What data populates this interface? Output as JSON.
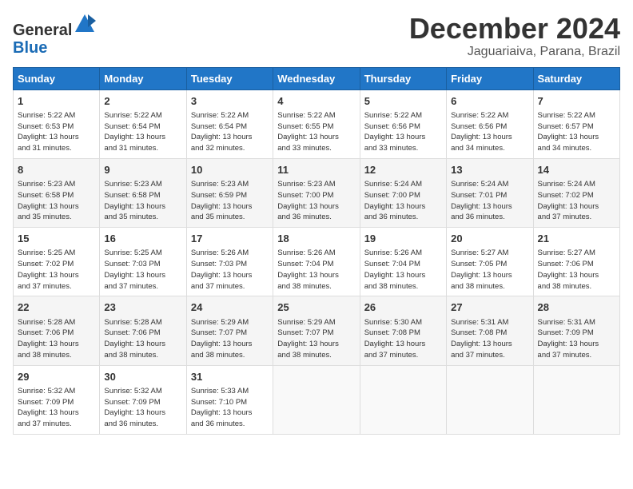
{
  "header": {
    "logo_line1": "General",
    "logo_line2": "Blue",
    "month": "December 2024",
    "location": "Jaguariaiva, Parana, Brazil"
  },
  "days_of_week": [
    "Sunday",
    "Monday",
    "Tuesday",
    "Wednesday",
    "Thursday",
    "Friday",
    "Saturday"
  ],
  "weeks": [
    [
      {
        "day": "1",
        "info": "Sunrise: 5:22 AM\nSunset: 6:53 PM\nDaylight: 13 hours\nand 31 minutes."
      },
      {
        "day": "2",
        "info": "Sunrise: 5:22 AM\nSunset: 6:54 PM\nDaylight: 13 hours\nand 31 minutes."
      },
      {
        "day": "3",
        "info": "Sunrise: 5:22 AM\nSunset: 6:54 PM\nDaylight: 13 hours\nand 32 minutes."
      },
      {
        "day": "4",
        "info": "Sunrise: 5:22 AM\nSunset: 6:55 PM\nDaylight: 13 hours\nand 33 minutes."
      },
      {
        "day": "5",
        "info": "Sunrise: 5:22 AM\nSunset: 6:56 PM\nDaylight: 13 hours\nand 33 minutes."
      },
      {
        "day": "6",
        "info": "Sunrise: 5:22 AM\nSunset: 6:56 PM\nDaylight: 13 hours\nand 34 minutes."
      },
      {
        "day": "7",
        "info": "Sunrise: 5:22 AM\nSunset: 6:57 PM\nDaylight: 13 hours\nand 34 minutes."
      }
    ],
    [
      {
        "day": "8",
        "info": "Sunrise: 5:23 AM\nSunset: 6:58 PM\nDaylight: 13 hours\nand 35 minutes."
      },
      {
        "day": "9",
        "info": "Sunrise: 5:23 AM\nSunset: 6:58 PM\nDaylight: 13 hours\nand 35 minutes."
      },
      {
        "day": "10",
        "info": "Sunrise: 5:23 AM\nSunset: 6:59 PM\nDaylight: 13 hours\nand 35 minutes."
      },
      {
        "day": "11",
        "info": "Sunrise: 5:23 AM\nSunset: 7:00 PM\nDaylight: 13 hours\nand 36 minutes."
      },
      {
        "day": "12",
        "info": "Sunrise: 5:24 AM\nSunset: 7:00 PM\nDaylight: 13 hours\nand 36 minutes."
      },
      {
        "day": "13",
        "info": "Sunrise: 5:24 AM\nSunset: 7:01 PM\nDaylight: 13 hours\nand 36 minutes."
      },
      {
        "day": "14",
        "info": "Sunrise: 5:24 AM\nSunset: 7:02 PM\nDaylight: 13 hours\nand 37 minutes."
      }
    ],
    [
      {
        "day": "15",
        "info": "Sunrise: 5:25 AM\nSunset: 7:02 PM\nDaylight: 13 hours\nand 37 minutes."
      },
      {
        "day": "16",
        "info": "Sunrise: 5:25 AM\nSunset: 7:03 PM\nDaylight: 13 hours\nand 37 minutes."
      },
      {
        "day": "17",
        "info": "Sunrise: 5:26 AM\nSunset: 7:03 PM\nDaylight: 13 hours\nand 37 minutes."
      },
      {
        "day": "18",
        "info": "Sunrise: 5:26 AM\nSunset: 7:04 PM\nDaylight: 13 hours\nand 38 minutes."
      },
      {
        "day": "19",
        "info": "Sunrise: 5:26 AM\nSunset: 7:04 PM\nDaylight: 13 hours\nand 38 minutes."
      },
      {
        "day": "20",
        "info": "Sunrise: 5:27 AM\nSunset: 7:05 PM\nDaylight: 13 hours\nand 38 minutes."
      },
      {
        "day": "21",
        "info": "Sunrise: 5:27 AM\nSunset: 7:06 PM\nDaylight: 13 hours\nand 38 minutes."
      }
    ],
    [
      {
        "day": "22",
        "info": "Sunrise: 5:28 AM\nSunset: 7:06 PM\nDaylight: 13 hours\nand 38 minutes."
      },
      {
        "day": "23",
        "info": "Sunrise: 5:28 AM\nSunset: 7:06 PM\nDaylight: 13 hours\nand 38 minutes."
      },
      {
        "day": "24",
        "info": "Sunrise: 5:29 AM\nSunset: 7:07 PM\nDaylight: 13 hours\nand 38 minutes."
      },
      {
        "day": "25",
        "info": "Sunrise: 5:29 AM\nSunset: 7:07 PM\nDaylight: 13 hours\nand 38 minutes."
      },
      {
        "day": "26",
        "info": "Sunrise: 5:30 AM\nSunset: 7:08 PM\nDaylight: 13 hours\nand 37 minutes."
      },
      {
        "day": "27",
        "info": "Sunrise: 5:31 AM\nSunset: 7:08 PM\nDaylight: 13 hours\nand 37 minutes."
      },
      {
        "day": "28",
        "info": "Sunrise: 5:31 AM\nSunset: 7:09 PM\nDaylight: 13 hours\nand 37 minutes."
      }
    ],
    [
      {
        "day": "29",
        "info": "Sunrise: 5:32 AM\nSunset: 7:09 PM\nDaylight: 13 hours\nand 37 minutes."
      },
      {
        "day": "30",
        "info": "Sunrise: 5:32 AM\nSunset: 7:09 PM\nDaylight: 13 hours\nand 36 minutes."
      },
      {
        "day": "31",
        "info": "Sunrise: 5:33 AM\nSunset: 7:10 PM\nDaylight: 13 hours\nand 36 minutes."
      },
      {
        "day": "",
        "info": ""
      },
      {
        "day": "",
        "info": ""
      },
      {
        "day": "",
        "info": ""
      },
      {
        "day": "",
        "info": ""
      }
    ]
  ]
}
